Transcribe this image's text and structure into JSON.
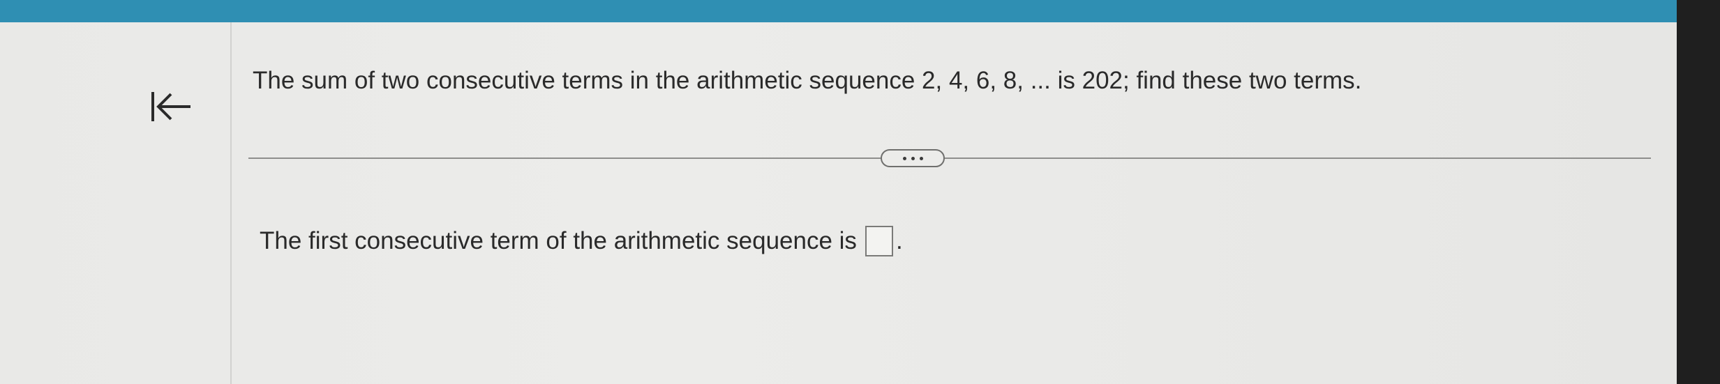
{
  "header": {
    "accent_color": "#2f8fb3"
  },
  "navigation": {
    "back_icon": "first-page-arrow-icon"
  },
  "question": {
    "text": "The sum of two consecutive terms in the arithmetic sequence 2, 4, 6, 8, ... is 202; find these two terms."
  },
  "expand": {
    "icon": "more-dots-icon"
  },
  "answer": {
    "prompt": "The first consecutive term of the arithmetic sequence is",
    "value": "",
    "suffix": "."
  }
}
